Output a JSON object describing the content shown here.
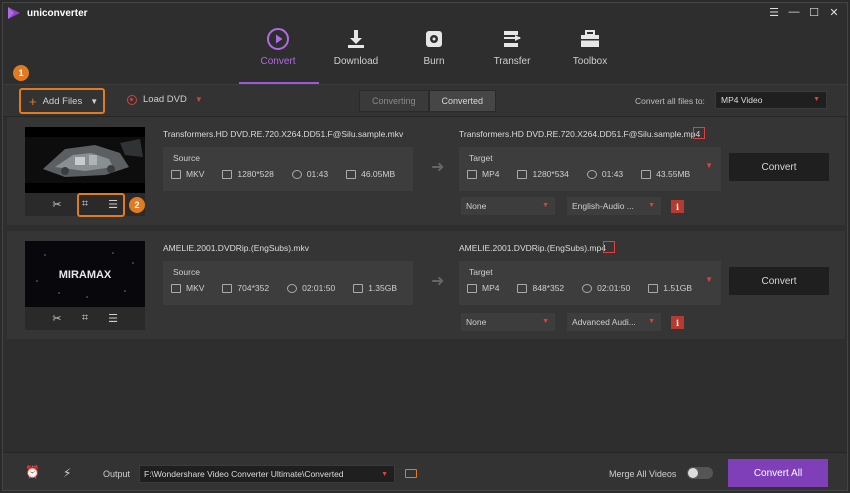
{
  "app": {
    "title": "uniconverter"
  },
  "nav": {
    "items": [
      {
        "label": "Convert",
        "icon": "play-circle-icon",
        "active": true
      },
      {
        "label": "Download",
        "icon": "download-icon"
      },
      {
        "label": "Burn",
        "icon": "burn-disc-icon"
      },
      {
        "label": "Transfer",
        "icon": "transfer-icon"
      },
      {
        "label": "Toolbox",
        "icon": "toolbox-icon"
      }
    ]
  },
  "toolbar": {
    "add_files": "Add Files",
    "load_dvd": "Load DVD",
    "tab_converting": "Converting",
    "tab_converted": "Converted",
    "convert_all_to_label": "Convert all files to:",
    "format": "MP4 Video",
    "badge_1": "1",
    "badge_2": "2"
  },
  "files": [
    {
      "source_name": "Transformers.HD DVD.RE.720.X264.DD51.F@Silu.sample.mkv",
      "source_label": "Source",
      "source": {
        "format": "MKV",
        "resolution": "1280*528",
        "duration": "01:43",
        "size": "46.05MB"
      },
      "target_name": "Transformers.HD DVD.RE.720.X264.DD51.F@Silu.sample.mp4",
      "target_label": "Target",
      "target": {
        "format": "MP4",
        "resolution": "1280*534",
        "duration": "01:43",
        "size": "43.55MB"
      },
      "subtitle": "None",
      "audio": "English-Audio ...",
      "convert": "Convert"
    },
    {
      "source_name": "AMELIE.2001.DVDRip.(EngSubs).mkv",
      "source_label": "Source",
      "source": {
        "format": "MKV",
        "resolution": "704*352",
        "duration": "02:01:50",
        "size": "1.35GB"
      },
      "target_name": "AMELIE.2001.DVDRip.(EngSubs).mp4",
      "target_label": "Target",
      "target": {
        "format": "MP4",
        "resolution": "848*352",
        "duration": "02:01:50",
        "size": "1.51GB"
      },
      "subtitle": "None",
      "audio": "Advanced Audi...",
      "convert": "Convert",
      "thumb_text": "MIRAMAX"
    }
  ],
  "bottom": {
    "output_label": "Output",
    "output_path": "F:\\Wondershare Video Converter Ultimate\\Converted",
    "merge_label": "Merge All Videos",
    "convert_all": "Convert All"
  }
}
